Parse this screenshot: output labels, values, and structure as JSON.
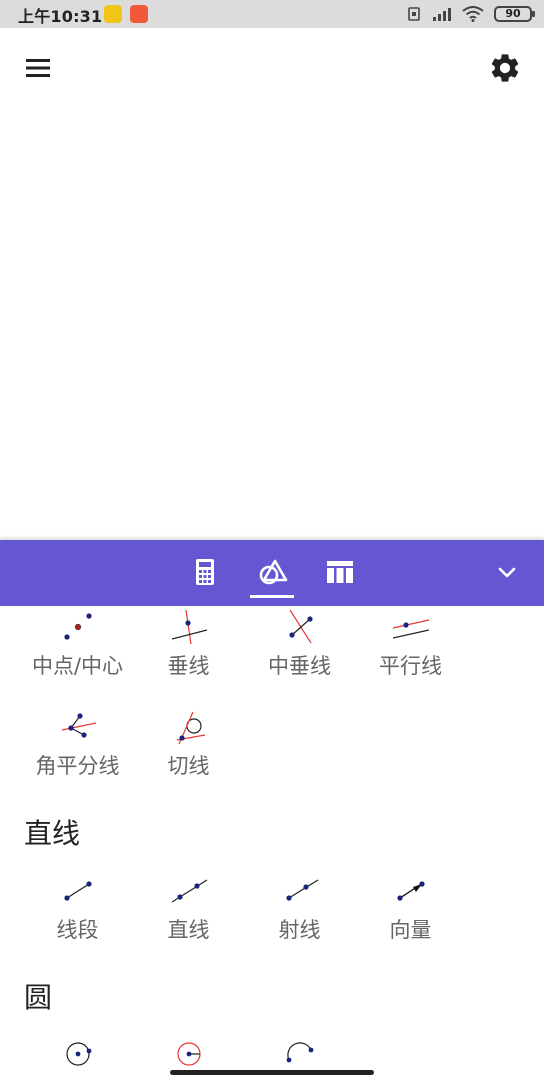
{
  "status_bar": {
    "time": "上午10:31",
    "battery": "90"
  },
  "toolbar": {
    "tabs": [
      {
        "name": "calculator-tab",
        "icon": "calculator-icon",
        "active": false
      },
      {
        "name": "tools-tab",
        "icon": "geometry-tools-icon",
        "active": true
      },
      {
        "name": "table-tab",
        "icon": "table-icon",
        "active": false
      }
    ],
    "accent": "#6557d2"
  },
  "tools_panel": {
    "construct_row1": [
      "中点/中心",
      "垂线",
      "中垂线",
      "平行线"
    ],
    "construct_row2": [
      "角平分线",
      "切线"
    ],
    "lines": {
      "title": "直线",
      "items": [
        "线段",
        "直线",
        "射线",
        "向量"
      ]
    },
    "circles": {
      "title": "圆"
    }
  }
}
